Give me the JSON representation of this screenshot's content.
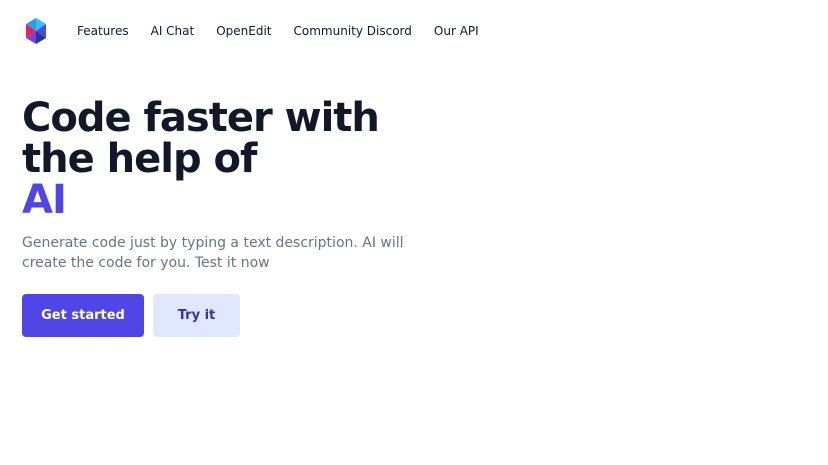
{
  "brand": {
    "logo_icon": "brand-logo-icon",
    "colors": {
      "top": "#1da1f2",
      "left": "#e0245e",
      "right": "#4f46e5",
      "bottom": "#1e3a8a"
    }
  },
  "nav": {
    "items": [
      {
        "label": "Features"
      },
      {
        "label": "AI Chat"
      },
      {
        "label": "OpenEdit"
      },
      {
        "label": "Community Discord"
      },
      {
        "label": "Our API"
      }
    ]
  },
  "hero": {
    "headline": "Code faster with the help of",
    "headline_accent": "AI",
    "subtitle": "Generate code just by typing a text description. AI will create the code for you. Test it now",
    "primary_button": "Get started",
    "secondary_button": "Try it"
  },
  "colors": {
    "accent": "#4f46e5",
    "secondary_bg": "#e0e7ff",
    "secondary_text": "#3730a3",
    "text": "#111827",
    "muted": "#6b7280"
  }
}
